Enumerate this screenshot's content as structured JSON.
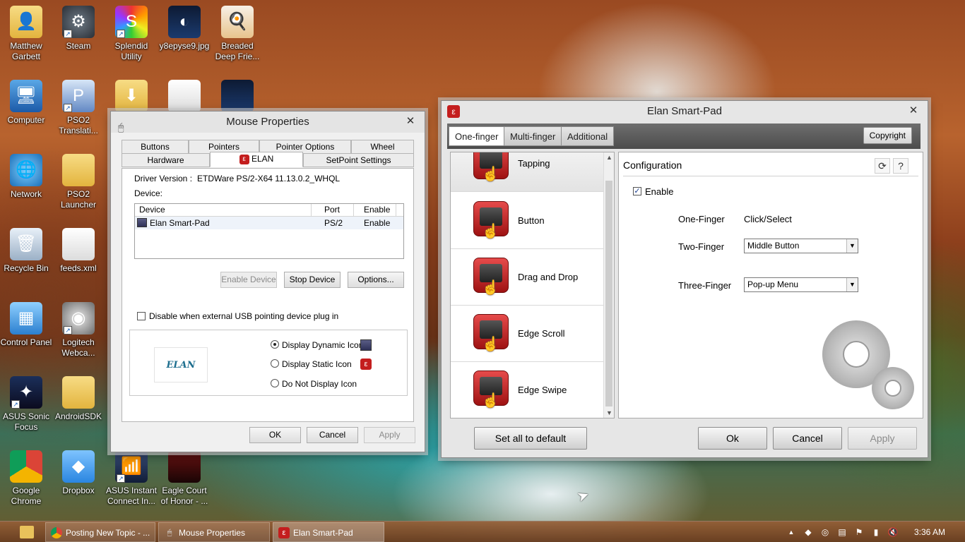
{
  "desktop": {
    "icons": [
      {
        "label": "Matthew Garbett",
        "icon": "user-folder-icon"
      },
      {
        "label": "Steam",
        "icon": "steam-icon"
      },
      {
        "label": "Splendid Utility",
        "icon": "splendid-icon"
      },
      {
        "label": "y8epyse9.jpg",
        "icon": "image-file-icon"
      },
      {
        "label": "Breaded Deep Frie...",
        "icon": "image-file-icon"
      },
      {
        "label": "Computer",
        "icon": "computer-icon"
      },
      {
        "label": "PSO2 Translati...",
        "icon": "pso2-icon"
      },
      {
        "label": "Network",
        "icon": "network-icon"
      },
      {
        "label": "PSO2 Launcher",
        "icon": "folder-icon"
      },
      {
        "label": "Recycle Bin",
        "icon": "recycle-bin-icon"
      },
      {
        "label": "feeds.xml",
        "icon": "document-icon"
      },
      {
        "label": "Control Panel",
        "icon": "control-panel-icon"
      },
      {
        "label": "Logitech Webca...",
        "icon": "webcam-icon"
      },
      {
        "label": "ASUS Sonic Focus",
        "icon": "asus-sonic-icon"
      },
      {
        "label": "AndroidSDK",
        "icon": "folder-icon"
      },
      {
        "label": "Google Chrome",
        "icon": "chrome-icon"
      },
      {
        "label": "Dropbox",
        "icon": "dropbox-icon"
      },
      {
        "label": "ASUS Instant Connect In...",
        "icon": "wifi-icon"
      },
      {
        "label": "Eagle Court of Honor - ...",
        "icon": "folder-icon"
      }
    ]
  },
  "mouse_properties": {
    "title": "Mouse Properties",
    "tabs_row1": [
      "Buttons",
      "Pointers",
      "Pointer Options",
      "Wheel"
    ],
    "tabs_row2": [
      "Hardware",
      "ELAN",
      "SetPoint Settings"
    ],
    "driver_label": "Driver Version :",
    "driver_value": "ETDWare PS/2-X64 11.13.0.2_WHQL",
    "device_label": "Device:",
    "columns": [
      "Device",
      "Port",
      "Enable"
    ],
    "rows": [
      {
        "device": "Elan Smart-Pad",
        "port": "PS/2",
        "enable": "Enable"
      }
    ],
    "btn_enable_device": "Enable Device",
    "btn_stop_device": "Stop Device",
    "btn_options": "Options...",
    "disable_usb_label": "Disable when external USB pointing device plug in",
    "disable_usb_checked": false,
    "logo_text": "ELAN",
    "radio_options": [
      {
        "label": "Display Dynamic Icon",
        "checked": true
      },
      {
        "label": "Display Static Icon",
        "checked": false
      },
      {
        "label": "Do Not Display Icon",
        "checked": false
      }
    ],
    "btn_ok": "OK",
    "btn_cancel": "Cancel",
    "btn_apply": "Apply"
  },
  "elan_smartpad": {
    "title": "Elan Smart-Pad",
    "tabs": [
      "One-finger",
      "Multi-finger",
      "Additional"
    ],
    "copyright_label": "Copyright",
    "features": [
      "Tapping",
      "Button",
      "Drag and Drop",
      "Edge Scroll",
      "Edge Swipe"
    ],
    "config_title": "Configuration",
    "enable_label": "Enable",
    "enable_checked": true,
    "one_finger_label": "One-Finger",
    "one_finger_value": "Click/Select",
    "two_finger_label": "Two-Finger",
    "two_finger_value": "Middle Button",
    "three_finger_label": "Three-Finger",
    "three_finger_value": "Pop-up Menu",
    "btn_set_default": "Set all to default",
    "btn_ok": "Ok",
    "btn_cancel": "Cancel",
    "btn_apply": "Apply"
  },
  "taskbar": {
    "buttons": [
      "Posting New Topic - ...",
      "Mouse Properties",
      "Elan Smart-Pad"
    ],
    "clock": "3:36 AM"
  }
}
